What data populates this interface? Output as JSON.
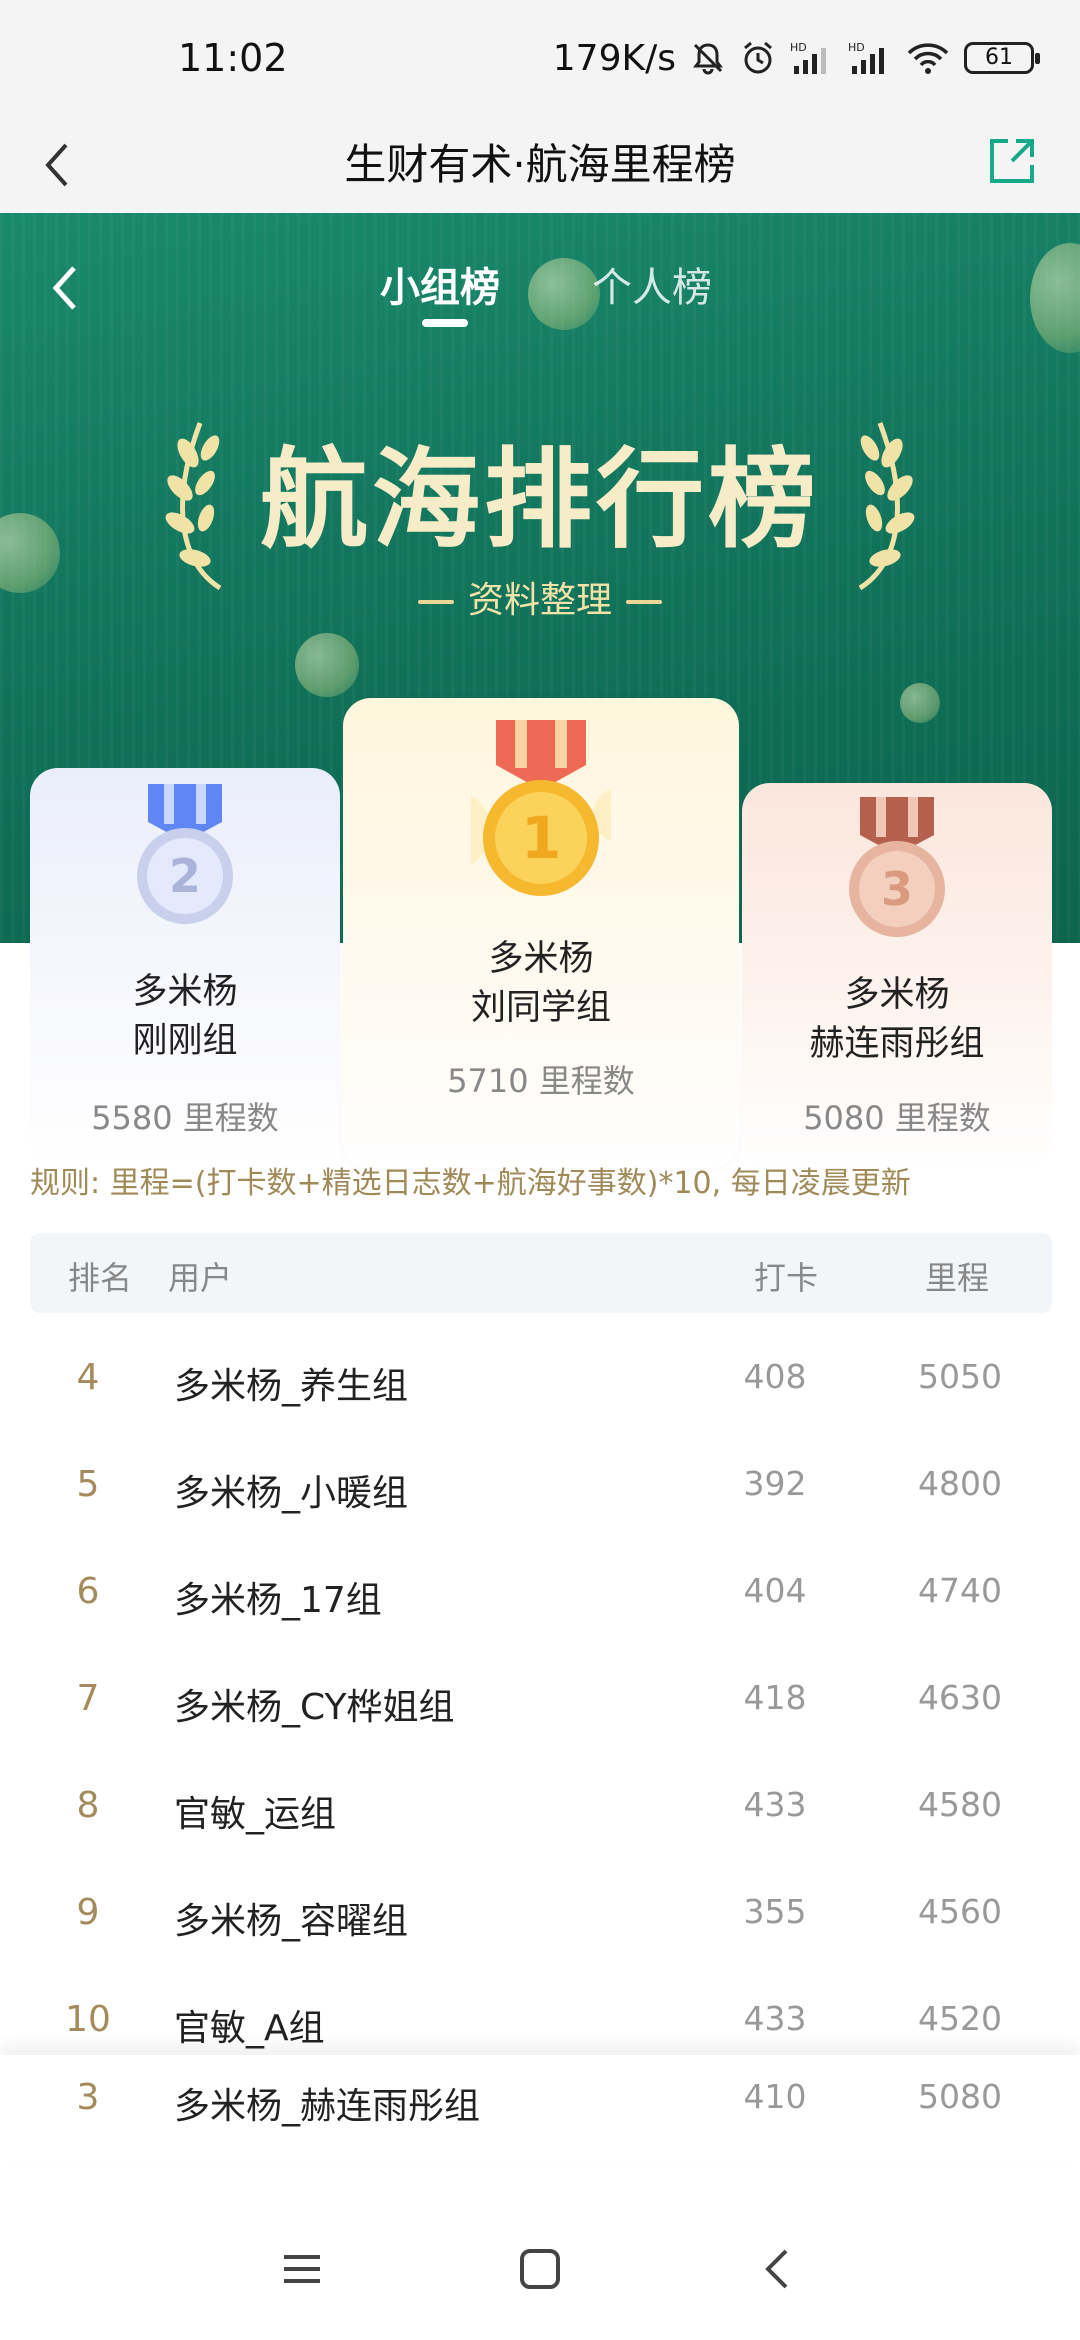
{
  "status_bar": {
    "time": "11:02",
    "network_speed": "179K/s",
    "battery": "61",
    "icons": [
      "mute-icon",
      "alarm-icon",
      "hd-signal-icon",
      "hd-signal-icon",
      "wifi-icon",
      "battery-icon"
    ]
  },
  "header": {
    "title": "生财有术·航海里程榜",
    "back_icon": "chevron-left-icon",
    "share_icon": "share-external-icon"
  },
  "banner": {
    "tabs": [
      {
        "label": "小组榜",
        "active": true
      },
      {
        "label": "个人榜",
        "active": false
      }
    ],
    "title": "航海排行榜",
    "subtitle": "资料整理",
    "colors": {
      "background": "#13775e",
      "title": "#f6ecc7",
      "subtitle": "#f3e3a8"
    }
  },
  "podium": [
    {
      "rank": "2",
      "name_line1": "多米杨",
      "name_line2": "刚刚组",
      "score": "5580 里程数",
      "medal": "silver-medal-icon"
    },
    {
      "rank": "1",
      "name_line1": "多米杨",
      "name_line2": "刘同学组",
      "score": "5710 里程数",
      "medal": "gold-medal-icon"
    },
    {
      "rank": "3",
      "name_line1": "多米杨",
      "name_line2": "赫连雨彤组",
      "score": "5080 里程数",
      "medal": "bronze-medal-icon"
    }
  ],
  "rule_text": "规则: 里程=(打卡数+精选日志数+航海好事数)*10, 每日凌晨更新",
  "table": {
    "headers": {
      "rank": "排名",
      "user": "用户",
      "check_in": "打卡",
      "miles": "里程"
    },
    "rows": [
      {
        "rank": "4",
        "name": "多米杨_养生组",
        "check_in": "408",
        "miles": "5050"
      },
      {
        "rank": "5",
        "name": "多米杨_小暖组",
        "check_in": "392",
        "miles": "4800"
      },
      {
        "rank": "6",
        "name": "多米杨_17组",
        "check_in": "404",
        "miles": "4740"
      },
      {
        "rank": "7",
        "name": "多米杨_CY桦姐组",
        "check_in": "418",
        "miles": "4630"
      },
      {
        "rank": "8",
        "name": "官敏_运组",
        "check_in": "433",
        "miles": "4580"
      },
      {
        "rank": "9",
        "name": "多米杨_容曜组",
        "check_in": "355",
        "miles": "4560"
      },
      {
        "rank": "10",
        "name": "官敏_A组",
        "check_in": "433",
        "miles": "4520"
      }
    ]
  },
  "my_row": {
    "rank": "3",
    "name": "多米杨_赫连雨彤组",
    "check_in": "410",
    "miles": "5080"
  },
  "nav": {
    "icons": [
      "menu-icon",
      "home-square-icon",
      "back-chevron-icon"
    ]
  }
}
